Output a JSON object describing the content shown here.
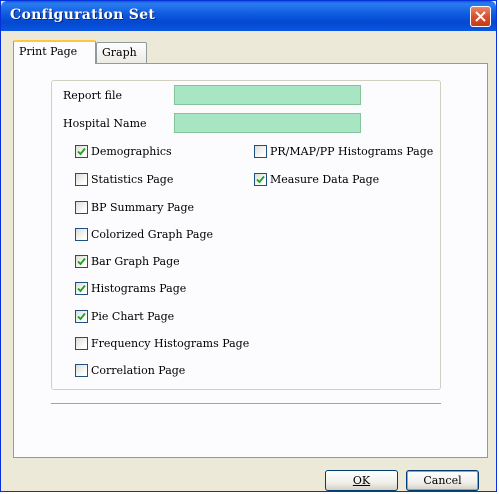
{
  "window": {
    "title": "Configuration Set"
  },
  "tabs": [
    {
      "label": "Print Page",
      "active": true
    },
    {
      "label": "Graph",
      "active": false
    }
  ],
  "fields": {
    "report_file": {
      "label": "Report file",
      "value": ""
    },
    "hospital_name": {
      "label": "Hospital Name",
      "value": ""
    }
  },
  "checkboxes": [
    {
      "label": "Demographics",
      "checked": true
    },
    {
      "label": "Statistics Page",
      "checked": false
    },
    {
      "label": "BP Summary Page",
      "checked": false
    },
    {
      "label": "Colorized Graph Page",
      "checked": false
    },
    {
      "label": "Bar Graph Page",
      "checked": true
    },
    {
      "label": "Histograms Page",
      "checked": true
    },
    {
      "label": "Pie Chart Page",
      "checked": true
    },
    {
      "label": "Frequency Histograms Page",
      "checked": false
    },
    {
      "label": "Correlation Page",
      "checked": false
    },
    {
      "label": "PR/MAP/PP Histograms Page",
      "checked": false
    },
    {
      "label": "Measure Data Page",
      "checked": true
    }
  ],
  "buttons": {
    "ok": "OK",
    "cancel": "Cancel"
  },
  "colors": {
    "title_bar": "#0548d0",
    "input_bg": "#a8e6c3",
    "dialog_bg": "#ece9d8",
    "tab_highlight": "#ffc83c"
  }
}
